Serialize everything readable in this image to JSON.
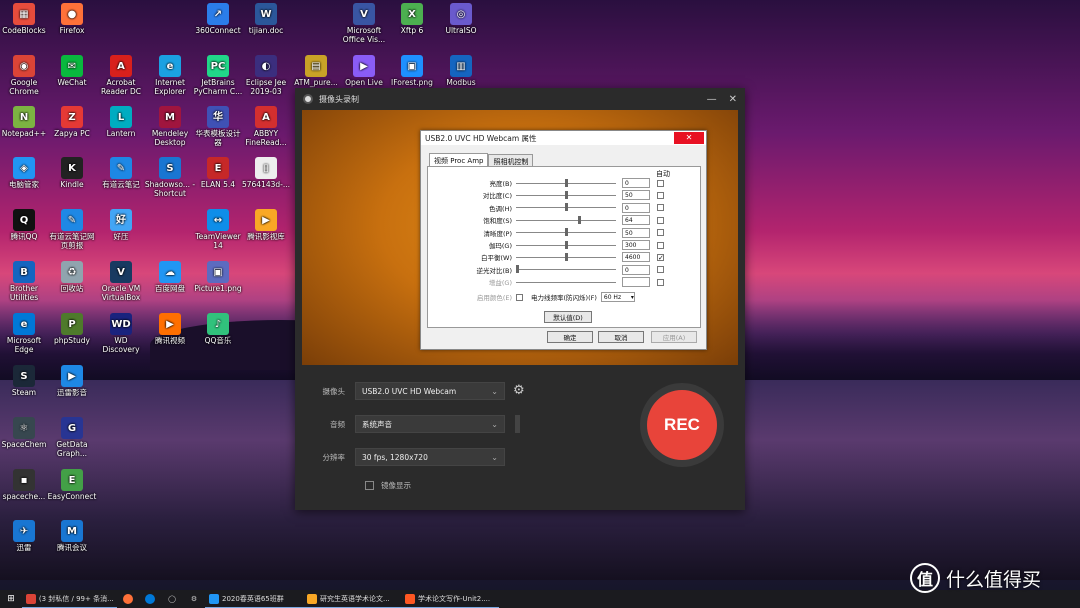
{
  "desktop": {
    "icons": [
      {
        "label": "CodeBlocks",
        "color": "#e74c3c",
        "glyph": "▦"
      },
      {
        "label": "Firefox",
        "color": "#ff7139",
        "glyph": "●"
      },
      {
        "label": "360Connect",
        "color": "#2b7de9",
        "glyph": "↗"
      },
      {
        "label": "tijian.doc",
        "color": "#2b579a",
        "glyph": "W"
      },
      {
        "label": "Microsoft Office Vis...",
        "color": "#3955a3",
        "glyph": "V"
      },
      {
        "label": "Xftp 6",
        "color": "#4caf50",
        "glyph": "X"
      },
      {
        "label": "UltraISO",
        "color": "#6a5acd",
        "glyph": "◎"
      },
      {
        "label": "Google Chrome",
        "color": "#db4437",
        "glyph": "◉"
      },
      {
        "label": "WeChat",
        "color": "#09b83e",
        "glyph": "✉"
      },
      {
        "label": "Acrobat Reader DC",
        "color": "#d8201c",
        "glyph": "A"
      },
      {
        "label": "Internet Explorer",
        "color": "#1ba1e2",
        "glyph": "e"
      },
      {
        "label": "JetBrains PyCharm C...",
        "color": "#21d789",
        "glyph": "PC"
      },
      {
        "label": "Eclipse Jee 2019-03",
        "color": "#3b2e7e",
        "glyph": "◐"
      },
      {
        "label": "ATM_pure...",
        "color": "#c9a227",
        "glyph": "▤"
      },
      {
        "label": "Open Live",
        "color": "#8a5cf6",
        "glyph": "▶"
      },
      {
        "label": "IForest.png",
        "color": "#1e90ff",
        "glyph": "▣"
      },
      {
        "label": "Modbus",
        "color": "#1565c0",
        "glyph": "▥"
      },
      {
        "label": "Notepad++",
        "color": "#7cb342",
        "glyph": "N"
      },
      {
        "label": "Zapya PC",
        "color": "#e53935",
        "glyph": "Z"
      },
      {
        "label": "Lantern",
        "color": "#00acc1",
        "glyph": "L"
      },
      {
        "label": "Mendeley Desktop",
        "color": "#a0153e",
        "glyph": "M"
      },
      {
        "label": "华表模板设计器",
        "color": "#3f51b5",
        "glyph": "华"
      },
      {
        "label": "ABBYY FineRead...",
        "color": "#d32f2f",
        "glyph": "A"
      },
      {
        "label": "电脑管家",
        "color": "#2196f3",
        "glyph": "◈"
      },
      {
        "label": "Kindle",
        "color": "#222222",
        "glyph": "K"
      },
      {
        "label": "有道云笔记",
        "color": "#1e88e5",
        "glyph": "✎"
      },
      {
        "label": "Shadowso... - Shortcut",
        "color": "#1976d2",
        "glyph": "S"
      },
      {
        "label": "ELAN 5.4",
        "color": "#c62828",
        "glyph": "E"
      },
      {
        "label": "5764143d-...",
        "color": "#eeeeee",
        "glyph": "▯"
      },
      {
        "label": "腾讯QQ",
        "color": "#111111",
        "glyph": "Q"
      },
      {
        "label": "有道云笔记网页剪报",
        "color": "#1e88e5",
        "glyph": "✎"
      },
      {
        "label": "好压",
        "color": "#42a5f5",
        "glyph": "好"
      },
      {
        "label": "TeamViewer 14",
        "color": "#0e8ee9",
        "glyph": "↔"
      },
      {
        "label": "腾讯影视库",
        "color": "#f9a825",
        "glyph": "▶"
      },
      {
        "label": "Brother Utilities",
        "color": "#1565c0",
        "glyph": "B"
      },
      {
        "label": "回收站",
        "color": "#90a4ae",
        "glyph": "♻"
      },
      {
        "label": "Oracle VM VirtualBox",
        "color": "#183a61",
        "glyph": "V"
      },
      {
        "label": "百度网盘",
        "color": "#2196f3",
        "glyph": "☁"
      },
      {
        "label": "Picture1.png",
        "color": "#5c6bc0",
        "glyph": "▣"
      },
      {
        "label": "Microsoft Edge",
        "color": "#0078d7",
        "glyph": "e"
      },
      {
        "label": "phpStudy",
        "color": "#4e7a2b",
        "glyph": "P"
      },
      {
        "label": "WD Discovery",
        "color": "#1a237e",
        "glyph": "WD"
      },
      {
        "label": "腾讯视频",
        "color": "#ff6f00",
        "glyph": "▶"
      },
      {
        "label": "QQ音乐",
        "color": "#31c27c",
        "glyph": "♪"
      },
      {
        "label": "Steam",
        "color": "#1b2838",
        "glyph": "S"
      },
      {
        "label": "迅雷影音",
        "color": "#1e88e5",
        "glyph": "▶"
      },
      {
        "label": "SpaceChem",
        "color": "#37474f",
        "glyph": "⚛"
      },
      {
        "label": "GetData Graph...",
        "color": "#283593",
        "glyph": "G"
      },
      {
        "label": "EasyConnect",
        "color": "#43a047",
        "glyph": "E"
      },
      {
        "label": "spaceche...",
        "color": "#333333",
        "glyph": "▪"
      },
      {
        "label": "迅雷",
        "color": "#1976d2",
        "glyph": "✈"
      },
      {
        "label": "腾讯会议",
        "color": "#1976d2",
        "glyph": "M"
      }
    ]
  },
  "app": {
    "title": "摄像头录制",
    "minimize_glyph": "—",
    "close_glyph": "✕",
    "camera_label": "摄像头",
    "camera_value": "USB2.0 UVC HD Webcam",
    "audio_label": "音频",
    "audio_value": "系统声音",
    "resolution_label": "分辨率",
    "resolution_value": "30 fps, 1280x720",
    "mirror_label": "镜像显示",
    "rec_label": "REC"
  },
  "dialog": {
    "title": "USB2.0 UVC HD Webcam 属性",
    "close_glyph": "✕",
    "tab_active": "视频 Proc Amp",
    "tab_inactive": "照相机控制",
    "auto_header": "自动",
    "properties": [
      {
        "label": "亮度(B)",
        "value": "0",
        "thumb": 0.5,
        "auto": false,
        "dim": false
      },
      {
        "label": "对比度(C)",
        "value": "50",
        "thumb": 0.5,
        "auto": false,
        "dim": false
      },
      {
        "label": "色调(H)",
        "value": "0",
        "thumb": 0.5,
        "auto": false,
        "dim": false
      },
      {
        "label": "饱和度(S)",
        "value": "64",
        "thumb": 0.64,
        "auto": false,
        "dim": false
      },
      {
        "label": "清晰度(P)",
        "value": "50",
        "thumb": 0.5,
        "auto": false,
        "dim": false
      },
      {
        "label": "伽玛(G)",
        "value": "300",
        "thumb": 0.5,
        "auto": false,
        "dim": false
      },
      {
        "label": "白平衡(W)",
        "value": "4600",
        "thumb": 0.5,
        "auto": true,
        "dim": false
      },
      {
        "label": "逆光对比(B)",
        "value": "0",
        "thumb": 0.0,
        "auto": false,
        "dim": false
      },
      {
        "label": "增益(G)",
        "value": "",
        "thumb": 0.0,
        "auto": false,
        "dim": true
      }
    ],
    "color_enable_label": "启用颜色(E)",
    "powerline_label": "电力线频率(防闪烁)(F)",
    "powerline_value": "60 Hz",
    "default_button": "默认值(D)",
    "ok_button": "确定",
    "cancel_button": "取消",
    "apply_button": "应用(A)"
  },
  "taskbar": {
    "items": [
      {
        "label": "(3 封私信 / 99+ 条消...",
        "color": "#db4437"
      },
      {
        "label": "2020春英语65班群",
        "color": "#2196f3"
      },
      {
        "label": "研究生英语学术论文...",
        "color": "#f9a825"
      },
      {
        "label": "学术论文写作-Unit2....",
        "color": "#ff5722"
      }
    ]
  },
  "watermark": {
    "badge": "值",
    "text": "什么值得买"
  }
}
